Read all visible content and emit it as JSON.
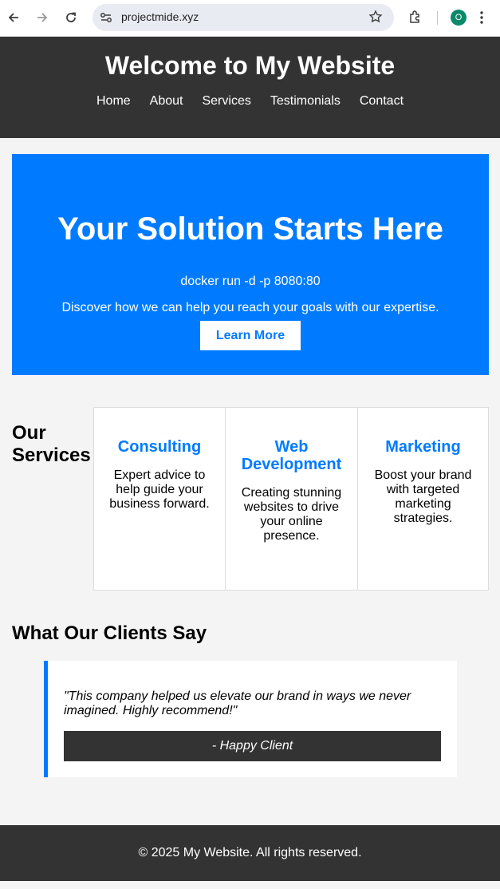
{
  "browser": {
    "url": "projectmide.xyz",
    "profile_initial": "O",
    "icons": [
      "back-arrow-icon",
      "forward-arrow-icon",
      "reload-icon",
      "site-settings-icon",
      "bookmark-star-icon",
      "extensions-icon",
      "more-menu-icon"
    ]
  },
  "header": {
    "title": "Welcome to My Website",
    "nav": [
      "Home",
      "About",
      "Services",
      "Testimonials",
      "Contact"
    ]
  },
  "hero": {
    "heading": "Your Solution Starts Here",
    "command": "docker run -d -p 8080:80",
    "description": "Discover how we can help you reach your goals with our expertise.",
    "button": "Learn More"
  },
  "services": {
    "heading": "Our Services",
    "items": [
      {
        "title": "Consulting",
        "text": "Expert advice to help guide your business forward."
      },
      {
        "title": "Web Development",
        "text": "Creating stunning websites to drive your online presence."
      },
      {
        "title": "Marketing",
        "text": "Boost your brand with targeted marketing strategies."
      }
    ]
  },
  "testimonials": {
    "heading": "What Our Clients Say",
    "quote": "\"This company helped us elevate our brand in ways we never imagined. Highly recommend!\"",
    "author": "- Happy Client"
  },
  "footer": {
    "text": "© 2025 My Website. All rights reserved."
  },
  "colors": {
    "accent": "#007bff",
    "dark": "#333333",
    "background": "#f4f4f4"
  }
}
